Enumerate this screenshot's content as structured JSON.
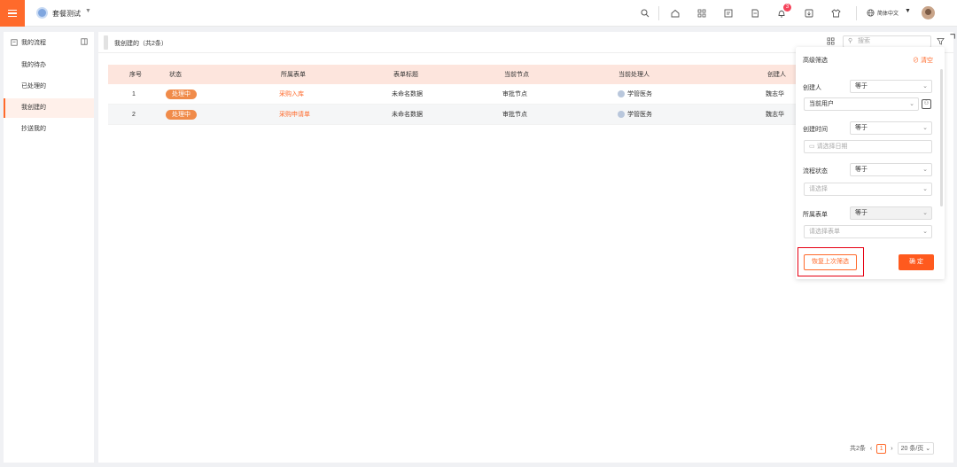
{
  "header": {
    "app_name": "套餐测试",
    "language": "简体中文",
    "notification_count": "3",
    "icons": [
      "search-icon",
      "home-icon",
      "apps-icon",
      "form-icon",
      "doc-icon",
      "bell-icon",
      "download-icon",
      "skin-icon",
      "globe-icon"
    ]
  },
  "sidebar": {
    "title": "我的流程",
    "items": [
      {
        "label": "我的待办"
      },
      {
        "label": "已处理的"
      },
      {
        "label": "我创建的"
      },
      {
        "label": "抄送我的"
      }
    ]
  },
  "main": {
    "tab_title": "我创建的（共2条）",
    "search_placeholder": "搜索"
  },
  "table": {
    "headers": [
      "序号",
      "状态",
      "所属表单",
      "表单标题",
      "当前节点",
      "当前处理人",
      "创建人"
    ],
    "rows": [
      {
        "index": "1",
        "status": "处理中",
        "form": "采购入库",
        "title": "未命名数据",
        "node": "审批节点",
        "handler": "学管医务",
        "creator": "魏志华"
      },
      {
        "index": "2",
        "status": "处理中",
        "form": "采购申请单",
        "title": "未命名数据",
        "node": "审批节点",
        "handler": "学管医务",
        "creator": "魏志华"
      }
    ]
  },
  "pagination": {
    "total": "共2条",
    "current": "1",
    "page_size": "20 条/页"
  },
  "filter": {
    "title": "高级筛选",
    "clear": "清空",
    "fields": [
      {
        "label": "创建人",
        "operator": "等于",
        "value": "当前用户"
      },
      {
        "label": "创建时间",
        "operator": "等于",
        "placeholder": "请选择日期"
      },
      {
        "label": "流程状态",
        "operator": "等于",
        "placeholder": "请选择"
      },
      {
        "label": "所属表单",
        "operator": "等于",
        "placeholder": "请选择表单"
      }
    ],
    "restore_label": "恢复上次筛选",
    "confirm_label": "确 定"
  },
  "colors": {
    "accent": "#ff6a2b",
    "highlight_box": "#e60012"
  }
}
